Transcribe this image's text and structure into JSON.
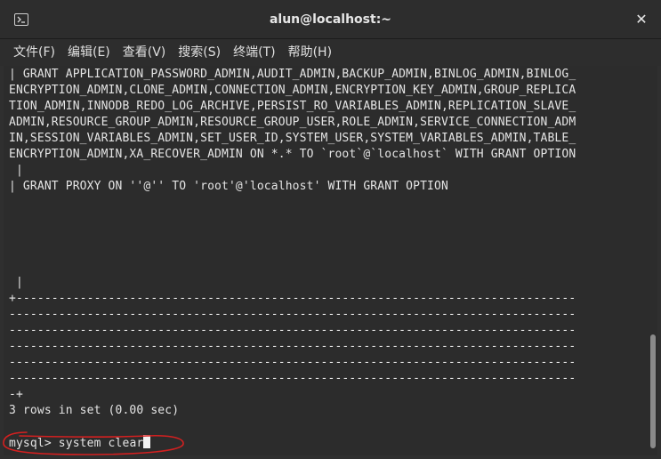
{
  "window": {
    "title": "alun@localhost:~",
    "close_glyph": "✕"
  },
  "menu": {
    "items": [
      "文件(F)",
      "编辑(E)",
      "查看(V)",
      "搜索(S)",
      "终端(T)",
      "帮助(H)"
    ]
  },
  "terminal": {
    "lines": [
      "| GRANT APPLICATION_PASSWORD_ADMIN,AUDIT_ADMIN,BACKUP_ADMIN,BINLOG_ADMIN,BINLOG_",
      "ENCRYPTION_ADMIN,CLONE_ADMIN,CONNECTION_ADMIN,ENCRYPTION_KEY_ADMIN,GROUP_REPLICA",
      "TION_ADMIN,INNODB_REDO_LOG_ARCHIVE,PERSIST_RO_VARIABLES_ADMIN,REPLICATION_SLAVE_",
      "ADMIN,RESOURCE_GROUP_ADMIN,RESOURCE_GROUP_USER,ROLE_ADMIN,SERVICE_CONNECTION_ADM",
      "IN,SESSION_VARIABLES_ADMIN,SET_USER_ID,SYSTEM_USER,SYSTEM_VARIABLES_ADMIN,TABLE_",
      "ENCRYPTION_ADMIN,XA_RECOVER_ADMIN ON *.* TO `root`@`localhost` WITH GRANT OPTION",
      " |",
      "| GRANT PROXY ON ''@'' TO 'root'@'localhost' WITH GRANT OPTION",
      "",
      "",
      "",
      "",
      "",
      " |",
      "+-------------------------------------------------------------------------------",
      "--------------------------------------------------------------------------------",
      "--------------------------------------------------------------------------------",
      "--------------------------------------------------------------------------------",
      "--------------------------------------------------------------------------------",
      "--------------------------------------------------------------------------------",
      "-+",
      "3 rows in set (0.00 sec)",
      "",
      ""
    ],
    "prompt": "mysql> ",
    "command": "system clear"
  },
  "colors": {
    "annotation": "#d42020",
    "text": "#e4e4e4",
    "background": "#2c2c2c"
  }
}
